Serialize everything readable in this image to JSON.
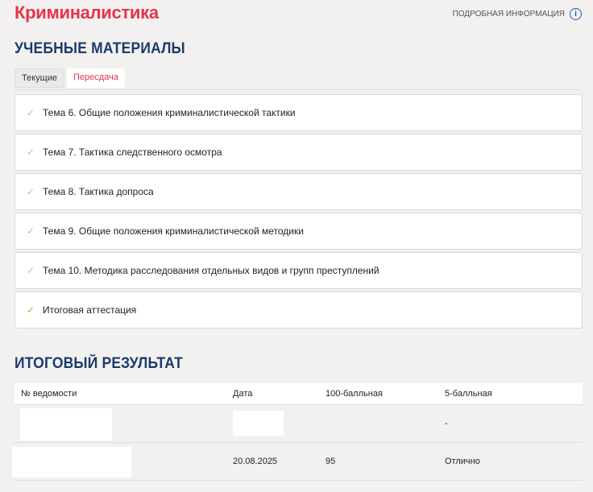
{
  "header": {
    "title": "Криминалистика",
    "info_link": "ПОДРОБНАЯ ИНФОРМАЦИЯ",
    "info_icon": "info-icon"
  },
  "materials": {
    "heading": "УЧЕБНЫЕ МАТЕРИАЛЫ",
    "tabs": [
      "Текущие",
      "Пересдача"
    ],
    "items": [
      {
        "label": "Тема 6. Общие положения криминалистической тактики",
        "done": false
      },
      {
        "label": "Тема 7. Тактика следственного осмотра",
        "done": false
      },
      {
        "label": "Тема 8. Тактика допроса",
        "done": false
      },
      {
        "label": "Тема 9. Общие положения криминалистической методики",
        "done": false
      },
      {
        "label": "Тема 10. Методика расследования отдельных видов и групп преступлений",
        "done": false
      },
      {
        "label": "Итоговая аттестация",
        "done": true
      }
    ]
  },
  "result": {
    "heading": "ИТОГОВЫЙ РЕЗУЛЬТАТ",
    "columns": [
      "№ ведомости",
      "Дата",
      "100-балльная",
      "5-балльная"
    ],
    "rows": [
      [
        "",
        "",
        "",
        "-"
      ],
      [
        "",
        "20.08.2025",
        "95",
        "Отлично"
      ]
    ]
  },
  "colors": {
    "accent": "#e8334a",
    "heading": "#1c3a6b",
    "check_done": "#8bc34a"
  }
}
